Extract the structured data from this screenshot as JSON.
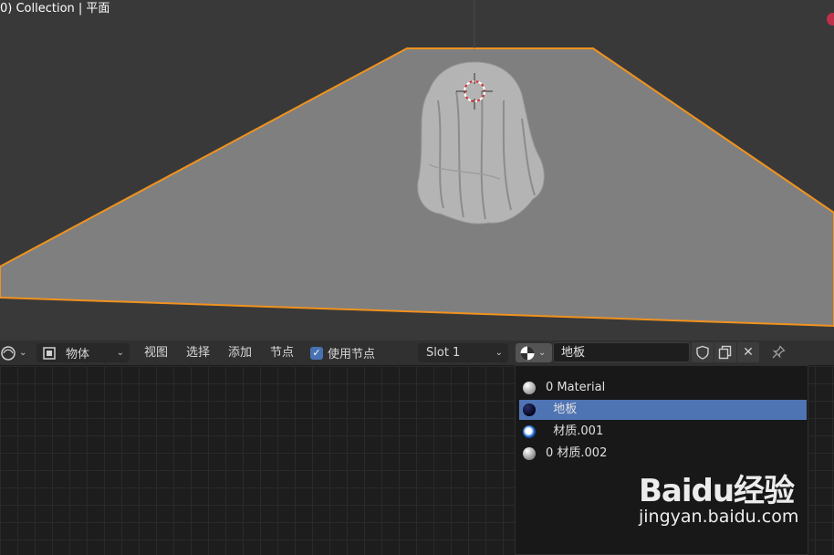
{
  "viewport": {
    "title": "0) Collection | 平面"
  },
  "header": {
    "mode_label": "物体",
    "menu": [
      "视图",
      "选择",
      "添加",
      "节点"
    ],
    "use_nodes_label": "使用节点",
    "use_nodes_checked": true,
    "slot_label": "Slot 1",
    "material_name": "地板"
  },
  "materials": {
    "items": [
      {
        "label": "0 Material",
        "ball": "white-sphere",
        "selected": false
      },
      {
        "label": "  地板",
        "ball": "dark-blue-sphere",
        "selected": true
      },
      {
        "label": "  材质.001",
        "ball": "blue-white-sphere",
        "selected": false
      },
      {
        "label": "0 材质.002",
        "ball": "white-sphere",
        "selected": false
      }
    ]
  },
  "watermark": {
    "logo": "Baidu经验",
    "url": "jingyan.baidu.com"
  },
  "colors": {
    "selection_outline": "#f0921e",
    "selected_item": "#4f74b4",
    "checkbox": "#4772b3"
  }
}
